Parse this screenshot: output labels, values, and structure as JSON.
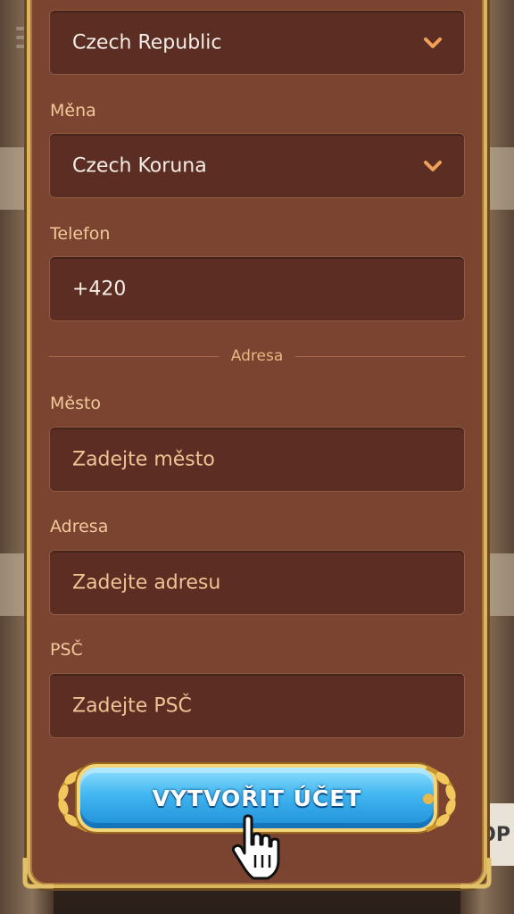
{
  "form": {
    "country": {
      "value": "Czech Republic"
    },
    "currency": {
      "label": "Měna",
      "value": "Czech Koruna"
    },
    "phone": {
      "label": "Telefon",
      "value": "+420"
    },
    "address_section": {
      "title": "Adresa"
    },
    "city": {
      "label": "Město",
      "placeholder": "Zadejte město"
    },
    "address": {
      "label": "Adresa",
      "placeholder": "Zadejte adresu"
    },
    "postal": {
      "label": "PSČ",
      "placeholder": "Zadejte PSČ"
    },
    "submit_label": "VYTVOŘIT ÚČET"
  },
  "background": {
    "side_button_text": "OP"
  },
  "colors": {
    "panel": "#7a4431",
    "field_bg": "#5c2e23",
    "label": "#f2c89a",
    "accent_gold": "#d9b65a",
    "cta_blue": "#41b6f0"
  },
  "icons": [
    "chevron-down-icon",
    "hand-pointer-icon",
    "laurel-icon"
  ]
}
